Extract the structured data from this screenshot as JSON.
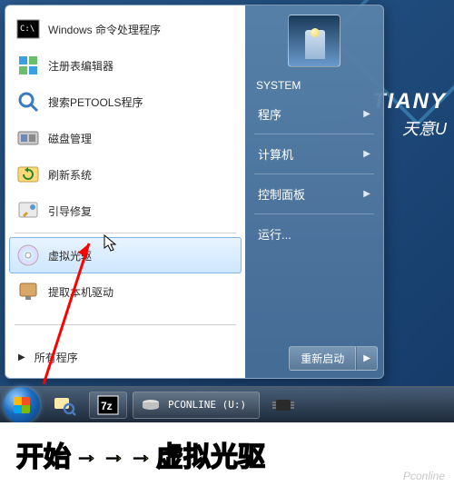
{
  "brand": {
    "en": "TIANY",
    "cn": "天意U"
  },
  "start_menu": {
    "left_items": [
      {
        "label": "Windows 命令处理程序",
        "icon": "cmd-icon"
      },
      {
        "label": "注册表编辑器",
        "icon": "regedit-icon"
      },
      {
        "label": "搜索PETOOLS程序",
        "icon": "search-icon"
      },
      {
        "label": "磁盘管理",
        "icon": "disk-icon"
      },
      {
        "label": "刷新系统",
        "icon": "refresh-icon"
      },
      {
        "label": "引导修复",
        "icon": "bootfix-icon"
      },
      {
        "label": "虚拟光驱",
        "icon": "cd-icon",
        "selected": true
      },
      {
        "label": "提取本机驱动",
        "icon": "driver-icon"
      }
    ],
    "all_programs": "所有程序",
    "right": {
      "user": "SYSTEM",
      "items": [
        {
          "label": "程序",
          "submenu": true
        },
        {
          "label": "计算机",
          "submenu": true
        },
        {
          "label": "控制面板",
          "submenu": true
        },
        {
          "label": "运行...",
          "submenu": false
        }
      ],
      "restart": "重新启动"
    }
  },
  "taskbar": {
    "drive_label": "PCONLINE (U:)"
  },
  "caption": {
    "word1": "开始",
    "word2": "虚拟光驱",
    "watermark": "Pconline"
  }
}
